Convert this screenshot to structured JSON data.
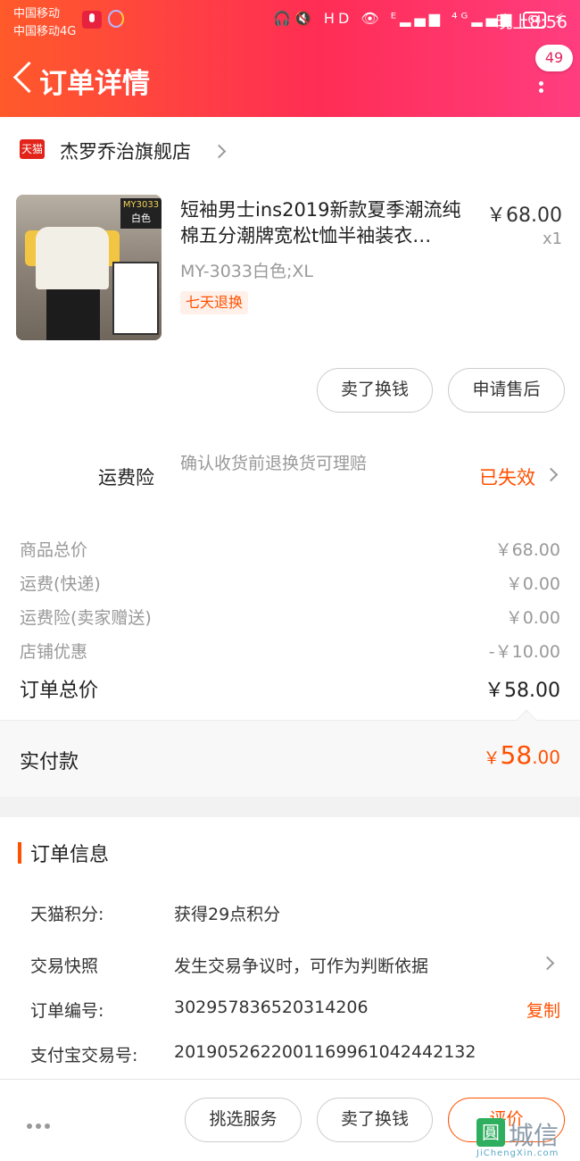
{
  "status_bar": {
    "carrier_1": "中国移动",
    "carrier_2": "中国移动4G",
    "icons": "🎧🔇 HD 👁 ᴱ▂▄▆ ⁴ᴳ▂▄▆",
    "battery": "64",
    "charging": "⚡",
    "time": "晚上8:56"
  },
  "nav": {
    "title": "订单详情",
    "message_count": "49"
  },
  "shop": {
    "badge": "天猫",
    "name": "杰罗乔治旗舰店"
  },
  "product": {
    "image_tag_code": "MY3033",
    "image_tag_color": "白色",
    "title": "短袖男士ins2019新款夏季潮流纯棉五分潮牌宽松t恤半袖装衣…",
    "price": "￥68.00",
    "quantity": "x1",
    "sku": "MY-3033白色;XL",
    "service_tag": "七天退换"
  },
  "item_actions": {
    "resell_label": "卖了换钱",
    "after_sale_label": "申请售后"
  },
  "insurance": {
    "label": "运费险",
    "description": "确认收货前退换货可理赔",
    "status": "已失效"
  },
  "price_breakdown": [
    {
      "label": "商品总价",
      "value": "￥68.00"
    },
    {
      "label": "运费(快递)",
      "value": "￥0.00"
    },
    {
      "label": "运费险(卖家赠送)",
      "value": "￥0.00"
    },
    {
      "label": "店铺优惠",
      "value": "-￥10.00"
    }
  ],
  "order_total": {
    "label": "订单总价",
    "value": "￥58.00"
  },
  "paid": {
    "label": "实付款",
    "currency": "￥",
    "integer": "58",
    "decimal": ".00"
  },
  "order_info": {
    "title": "订单信息",
    "rows": [
      {
        "key": "天猫积分:",
        "value": "获得29点积分"
      },
      {
        "key": "交易快照",
        "value": "发生交易争议时，可作为判断依据"
      },
      {
        "key": "订单编号:",
        "value": "302957836520314206",
        "action": "复制"
      },
      {
        "key": "支付宝交易号:",
        "value": "2019052622001169961042442132"
      }
    ]
  },
  "bottom_bar": {
    "service_label": "挑选服务",
    "resell_label": "卖了换钱",
    "rate_label": "评价"
  },
  "watermark": {
    "icon_char": "圓",
    "text": "城信",
    "sub": "JiChengXin.com"
  },
  "colors": {
    "accent": "#ff5000",
    "header_start": "#ff5a2a",
    "header_end": "#ff3d7f"
  }
}
